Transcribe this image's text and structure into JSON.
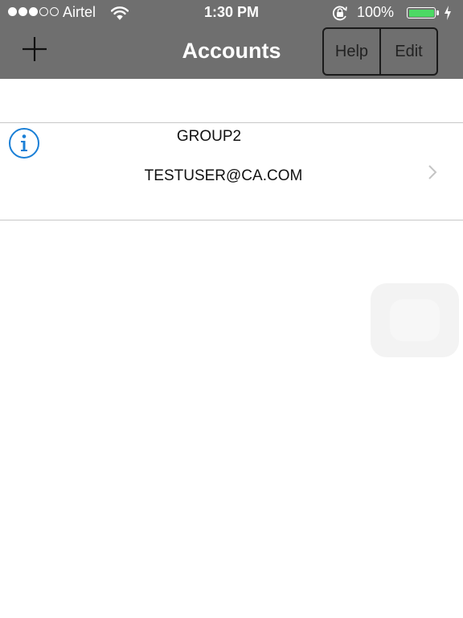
{
  "status_bar": {
    "carrier": "Airtel",
    "signal_bars_filled": 3,
    "signal_bars_total": 5,
    "time": "1:30 PM",
    "battery_percent": "100%",
    "battery_level": 1.0,
    "icons": [
      "wifi-icon",
      "rotation-lock-icon",
      "battery-icon",
      "charging-icon"
    ]
  },
  "nav": {
    "title": "Accounts",
    "add_icon": "plus-icon",
    "help_label": "Help",
    "edit_label": "Edit"
  },
  "accounts": [
    {
      "group": "GROUP2",
      "email": "TESTUSER@CA.COM",
      "info_icon": "info-icon",
      "disclosure_icon": "chevron-right-icon"
    }
  ],
  "colors": {
    "bar_background": "#6f6f6f",
    "battery_green": "#4cd964",
    "info_blue": "#1a7fd6",
    "separator": "#c8c8c8"
  }
}
